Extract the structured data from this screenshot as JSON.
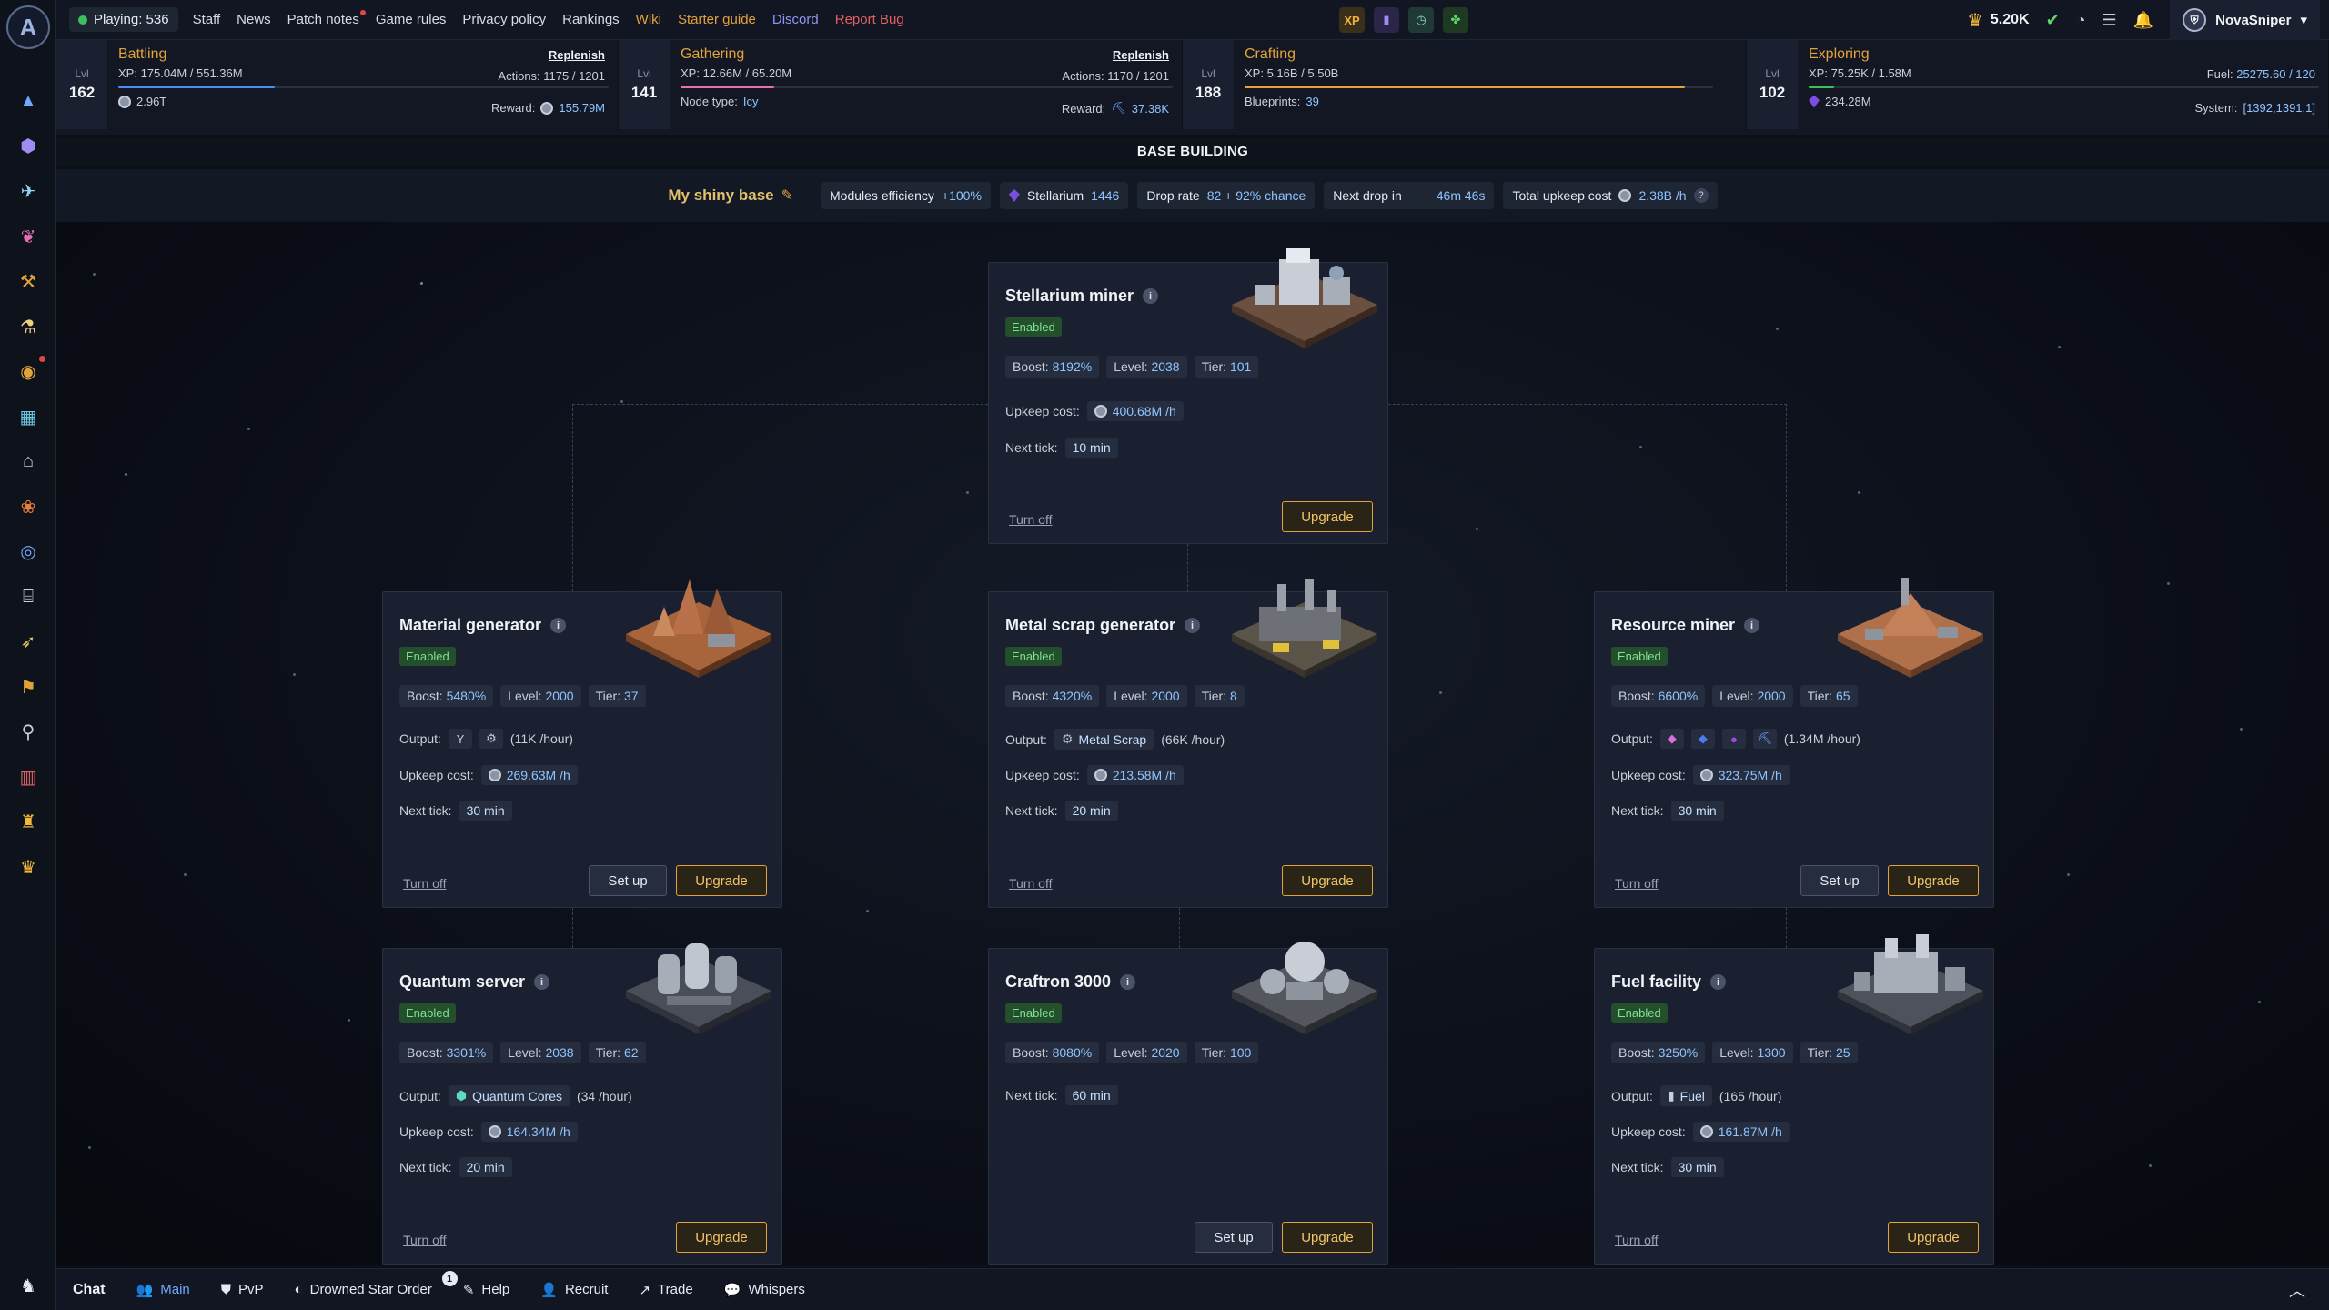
{
  "nav": {
    "playing_label": "Playing: 536",
    "links": [
      "Staff",
      "News",
      "Patch notes",
      "Game rules",
      "Privacy policy",
      "Rankings",
      "Wiki",
      "Starter guide",
      "Discord",
      "Report Bug"
    ]
  },
  "top_right": {
    "currency": "5.20K",
    "username": "NovaSniper"
  },
  "top_icons": {
    "xp": "XP"
  },
  "skills": [
    {
      "name": "Battling",
      "level_label": "Lvl",
      "level": "162",
      "xp": "XP: 175.04M / 551.36M",
      "xp_fraction": 0.32,
      "action": "Replenish",
      "actions": "Actions: 1175 / 1201",
      "stat": "2.96T",
      "reward_label": "Reward:",
      "reward": "155.79M"
    },
    {
      "name": "Gathering",
      "level_label": "Lvl",
      "level": "141",
      "xp": "XP: 12.66M / 65.20M",
      "xp_fraction": 0.19,
      "action": "Replenish",
      "actions": "Actions: 1170 / 1201",
      "node_label": "Node type:",
      "node": "Icy",
      "reward_label": "Reward:",
      "reward": "37.38K"
    },
    {
      "name": "Crafting",
      "level_label": "Lvl",
      "level": "188",
      "xp": "XP: 5.16B / 5.50B",
      "xp_fraction": 0.94,
      "blueprints_label": "Blueprints:",
      "blueprints": "39"
    },
    {
      "name": "Exploring",
      "level_label": "Lvl",
      "level": "102",
      "xp": "XP: 75.25K / 1.58M",
      "xp_fraction": 0.05,
      "fuel_label": "Fuel:",
      "fuel": "25275.60 / 120",
      "stat": "234.28M",
      "system_label": "System:",
      "system": "[1392,1391,1]"
    }
  ],
  "base": {
    "header": "BASE BUILDING",
    "name": "My shiny base",
    "chips": {
      "efficiency_label": "Modules efficiency",
      "efficiency": "+100%",
      "stellarium_label": "Stellarium",
      "stellarium": "1446",
      "drop_rate_label": "Drop rate",
      "drop_rate": "82 + 92% chance",
      "next_drop_label": "Next drop in",
      "next_drop": "46m 46s",
      "upkeep_label": "Total upkeep cost",
      "upkeep": "2.38B /h",
      "help": "?"
    }
  },
  "labels": {
    "enabled": "Enabled",
    "boost": "Boost:",
    "level": "Level:",
    "tier": "Tier:",
    "output": "Output:",
    "upkeep": "Upkeep cost:",
    "next_tick": "Next tick:",
    "turn_off": "Turn off",
    "set_up": "Set up",
    "upgrade": "Upgrade",
    "info": "i"
  },
  "modules": {
    "stellarium_miner": {
      "title": "Stellarium miner",
      "boost": "8192%",
      "level": "2038",
      "tier": "101",
      "upkeep": "400.68M /h",
      "next_tick": "10 min"
    },
    "material_generator": {
      "title": "Material generator",
      "boost": "5480%",
      "level": "2000",
      "tier": "37",
      "rate": "(11K /hour)",
      "upkeep": "269.63M /h",
      "next_tick": "30 min"
    },
    "metal_scrap_generator": {
      "title": "Metal scrap generator",
      "boost": "4320%",
      "level": "2000",
      "tier": "8",
      "output": "Metal Scrap",
      "rate": "(66K /hour)",
      "upkeep": "213.58M /h",
      "next_tick": "20 min"
    },
    "resource_miner": {
      "title": "Resource miner",
      "boost": "6600%",
      "level": "2000",
      "tier": "65",
      "rate": "(1.34M /hour)",
      "upkeep": "323.75M /h",
      "next_tick": "30 min"
    },
    "quantum_server": {
      "title": "Quantum server",
      "boost": "3301%",
      "level": "2038",
      "tier": "62",
      "output": "Quantum Cores",
      "rate": "(34 /hour)",
      "upkeep": "164.34M /h",
      "next_tick": "20 min"
    },
    "craftron_3000": {
      "title": "Craftron 3000",
      "boost": "8080%",
      "level": "2020",
      "tier": "100",
      "next_tick": "60 min"
    },
    "fuel_facility": {
      "title": "Fuel facility",
      "boost": "3250%",
      "level": "1300",
      "tier": "25",
      "output": "Fuel",
      "rate": "(165 /hour)",
      "upkeep": "161.87M /h",
      "next_tick": "30 min"
    }
  },
  "chat": {
    "title": "Chat",
    "tabs": [
      "Main",
      "PvP",
      "Drowned Star Order",
      "Help",
      "Recruit",
      "Trade",
      "Whispers"
    ],
    "drowned_count": "1"
  },
  "colors": {
    "accent": "#e2a33a",
    "enabled": "#7fe08e",
    "value": "#8fc4ff",
    "link": "#6fa8ff"
  }
}
